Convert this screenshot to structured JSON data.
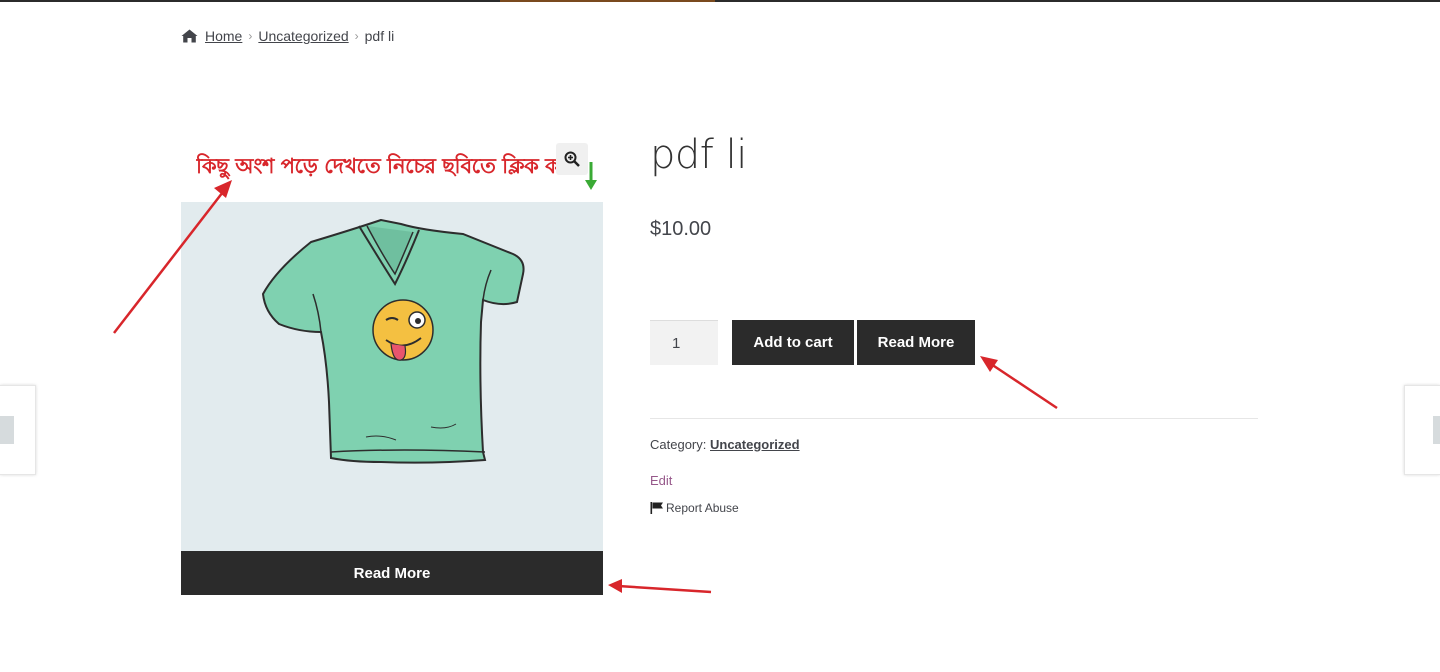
{
  "breadcrumb": {
    "home": "Home",
    "category": "Uncategorized",
    "current": "pdf li"
  },
  "gallery": {
    "annotation_text": "কিছু অংশ পড়ে দেখতে নিচের ছবিতে ক্লিক করুন",
    "zoom_icon": "zoom-in-icon",
    "read_more_label": "Read More"
  },
  "product": {
    "title": "pdf li",
    "price": "$10.00",
    "quantity": "1",
    "add_to_cart_label": "Add to cart",
    "read_more_label": "Read More",
    "category_label": "Category:",
    "category_value": "Uncategorized",
    "edit_label": "Edit",
    "report_abuse_label": "Report Abuse"
  },
  "colors": {
    "button_dark": "#2b2b2b",
    "annotation_red": "#d8262b",
    "arrow_green": "#3aaa35",
    "edit_link": "#96588a",
    "image_bg": "#e2ebee",
    "shirt": "#7fd1b0"
  }
}
